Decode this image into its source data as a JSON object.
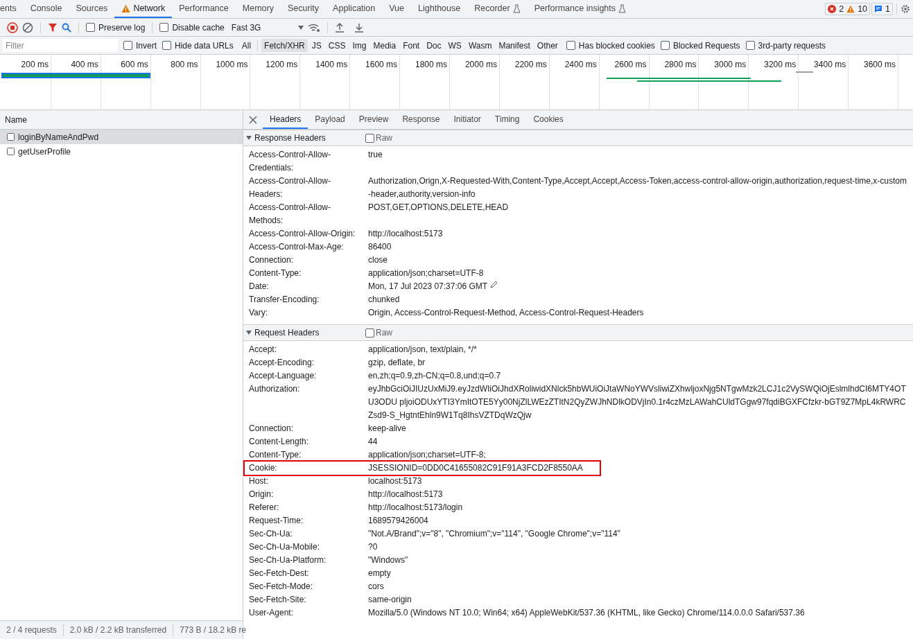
{
  "top_tabs": [
    {
      "label": "ents",
      "kind": "plain",
      "selected": false
    },
    {
      "label": "Console",
      "kind": "plain",
      "selected": false
    },
    {
      "label": "Sources",
      "kind": "plain",
      "selected": false
    },
    {
      "label": "Network",
      "kind": "warning",
      "selected": true
    },
    {
      "label": "Performance",
      "kind": "plain",
      "selected": false
    },
    {
      "label": "Memory",
      "kind": "plain",
      "selected": false
    },
    {
      "label": "Security",
      "kind": "plain",
      "selected": false
    },
    {
      "label": "Application",
      "kind": "plain",
      "selected": false
    },
    {
      "label": "Vue",
      "kind": "plain",
      "selected": false
    },
    {
      "label": "Lighthouse",
      "kind": "plain",
      "selected": false
    },
    {
      "label": "Recorder",
      "kind": "experimental",
      "selected": false
    },
    {
      "label": "Performance insights",
      "kind": "experimental",
      "selected": false
    }
  ],
  "counters": {
    "errors": "2",
    "warnings": "10",
    "messages": "1"
  },
  "toolbar": {
    "checkboxes": [
      {
        "label": "Preserve log",
        "checked": false
      },
      {
        "label": "Disable cache",
        "checked": false
      }
    ],
    "throttling": "Fast 3G"
  },
  "filter_bar": {
    "placeholder": "Filter",
    "left_checkboxes": [
      {
        "label": "Invert",
        "checked": false
      },
      {
        "label": "Hide data URLs",
        "checked": false
      }
    ],
    "types": [
      {
        "label": "All",
        "selected": false
      },
      {
        "label": "Fetch/XHR",
        "selected": true
      },
      {
        "label": "JS",
        "selected": false
      },
      {
        "label": "CSS",
        "selected": false
      },
      {
        "label": "Img",
        "selected": false
      },
      {
        "label": "Media",
        "selected": false
      },
      {
        "label": "Font",
        "selected": false
      },
      {
        "label": "Doc",
        "selected": false
      },
      {
        "label": "WS",
        "selected": false
      },
      {
        "label": "Wasm",
        "selected": false
      },
      {
        "label": "Manifest",
        "selected": false
      },
      {
        "label": "Other",
        "selected": false
      }
    ],
    "right_checkboxes": [
      {
        "label": "Has blocked cookies",
        "checked": false
      },
      {
        "label": "Blocked Requests",
        "checked": false
      },
      {
        "label": "3rd-party requests",
        "checked": false
      }
    ]
  },
  "timeline": {
    "ticks": [
      "200 ms",
      "400 ms",
      "600 ms",
      "800 ms",
      "1000 ms",
      "1200 ms",
      "1400 ms",
      "1600 ms",
      "1800 ms",
      "2000 ms",
      "2200 ms",
      "2400 ms",
      "2600 ms",
      "2800 ms",
      "3000 ms",
      "3200 ms",
      "3400 ms",
      "3600 ms"
    ]
  },
  "requests": {
    "column": "Name",
    "rows": [
      {
        "name": "loginByNameAndPwd",
        "selected": true
      },
      {
        "name": "getUserProfile",
        "selected": false
      }
    ]
  },
  "status_bar": [
    "2 / 4 requests",
    "2.0 kB / 2.2 kB transferred",
    "773 B / 18.2 kB re"
  ],
  "detail_tabs": [
    {
      "label": "Headers",
      "selected": true
    },
    {
      "label": "Payload",
      "selected": false
    },
    {
      "label": "Preview",
      "selected": false
    },
    {
      "label": "Response",
      "selected": false
    },
    {
      "label": "Initiator",
      "selected": false
    },
    {
      "label": "Timing",
      "selected": false
    },
    {
      "label": "Cookies",
      "selected": false
    }
  ],
  "response_headers": {
    "title": "Response Headers",
    "raw_label": "Raw",
    "raw_checked": false,
    "expanded": true,
    "rows": [
      {
        "name": "Access-Control-Allow-Credentials:",
        "value": "true",
        "editable": false
      },
      {
        "name": "Access-Control-Allow-Headers:",
        "value": "Authorization,Orign,X-Requested-With,Content-Type,Accept,Accept,Access-Token,access-control-allow-origin,authorization,request-time,x-custom-header,authority,version-info",
        "editable": false
      },
      {
        "name": "Access-Control-Allow-Methods:",
        "value": "POST,GET,OPTIONS,DELETE,HEAD",
        "editable": false
      },
      {
        "name": "Access-Control-Allow-Origin:",
        "value": "http://localhost:5173",
        "editable": false
      },
      {
        "name": "Access-Control-Max-Age:",
        "value": "86400",
        "editable": false
      },
      {
        "name": "Connection:",
        "value": "close",
        "editable": false
      },
      {
        "name": "Content-Type:",
        "value": "application/json;charset=UTF-8",
        "editable": false
      },
      {
        "name": "Date:",
        "value": "Mon, 17 Jul 2023 07:37:06 GMT",
        "editable": true
      },
      {
        "name": "Transfer-Encoding:",
        "value": "chunked",
        "editable": false
      },
      {
        "name": "Vary:",
        "value": "Origin, Access-Control-Request-Method, Access-Control-Request-Headers",
        "editable": false
      }
    ]
  },
  "request_headers": {
    "title": "Request Headers",
    "raw_label": "Raw",
    "raw_checked": false,
    "expanded": true,
    "rows": [
      {
        "name": "Accept:",
        "value": "application/json, text/plain, */*",
        "highlighted": false
      },
      {
        "name": "Accept-Encoding:",
        "value": "gzip, deflate, br",
        "highlighted": false
      },
      {
        "name": "Accept-Language:",
        "value": "en,zh;q=0.9,zh-CN;q=0.8,und;q=0.7",
        "highlighted": false
      },
      {
        "name": "Authorization:",
        "value": "eyJhbGciOiJIUzUxMiJ9.eyJzdWIiOiJhdXRoliwidXNlck5hbWUiOiJtaWNoYWVsliwiZXhwljoxNjg5NTgwMzk2LCJ1c2VySWQiOjEslmlhdCI6MTY4OTU3ODU pljoiODUxYTI3YmItOTE5Yy00NjZlLWEzZTItN2QyZWJhNDlkODVjIn0.1r4czMzLAWahCUldTGgw97fqdiBGXFCfzkr-bGT9Z7MpL4kRWRCZsd9-S_HgtntEhln9W1Tq8IhsVZTDqWzQjw",
        "highlighted": false
      },
      {
        "name": "Connection:",
        "value": "keep-alive",
        "highlighted": false
      },
      {
        "name": "Content-Length:",
        "value": "44",
        "highlighted": false
      },
      {
        "name": "Content-Type:",
        "value": "application/json;charset=UTF-8;",
        "highlighted": false
      },
      {
        "name": "Cookie:",
        "value": "JSESSIONID=0DD0C41655082C91F91A3FCD2F8550AA",
        "highlighted": true
      },
      {
        "name": "Host:",
        "value": "localhost:5173",
        "highlighted": false
      },
      {
        "name": "Origin:",
        "value": "http://localhost:5173",
        "highlighted": false
      },
      {
        "name": "Referer:",
        "value": "http://localhost:5173/login",
        "highlighted": false
      },
      {
        "name": "Request-Time:",
        "value": "1689579426004",
        "highlighted": false
      },
      {
        "name": "Sec-Ch-Ua:",
        "value": "\"Not.A/Brand\";v=\"8\", \"Chromium\";v=\"114\", \"Google Chrome\";v=\"114\"",
        "highlighted": false
      },
      {
        "name": "Sec-Ch-Ua-Mobile:",
        "value": "?0",
        "highlighted": false
      },
      {
        "name": "Sec-Ch-Ua-Platform:",
        "value": "\"Windows\"",
        "highlighted": false
      },
      {
        "name": "Sec-Fetch-Dest:",
        "value": "empty",
        "highlighted": false
      },
      {
        "name": "Sec-Fetch-Mode:",
        "value": "cors",
        "highlighted": false
      },
      {
        "name": "Sec-Fetch-Site:",
        "value": "same-origin",
        "highlighted": false
      },
      {
        "name": "User-Agent:",
        "value": "Mozilla/5.0 (Windows NT 10.0; Win64; x64) AppleWebKit/537.36 (KHTML, like Gecko) Chrome/114.0.0.0 Safari/537.36",
        "highlighted": false
      }
    ]
  }
}
